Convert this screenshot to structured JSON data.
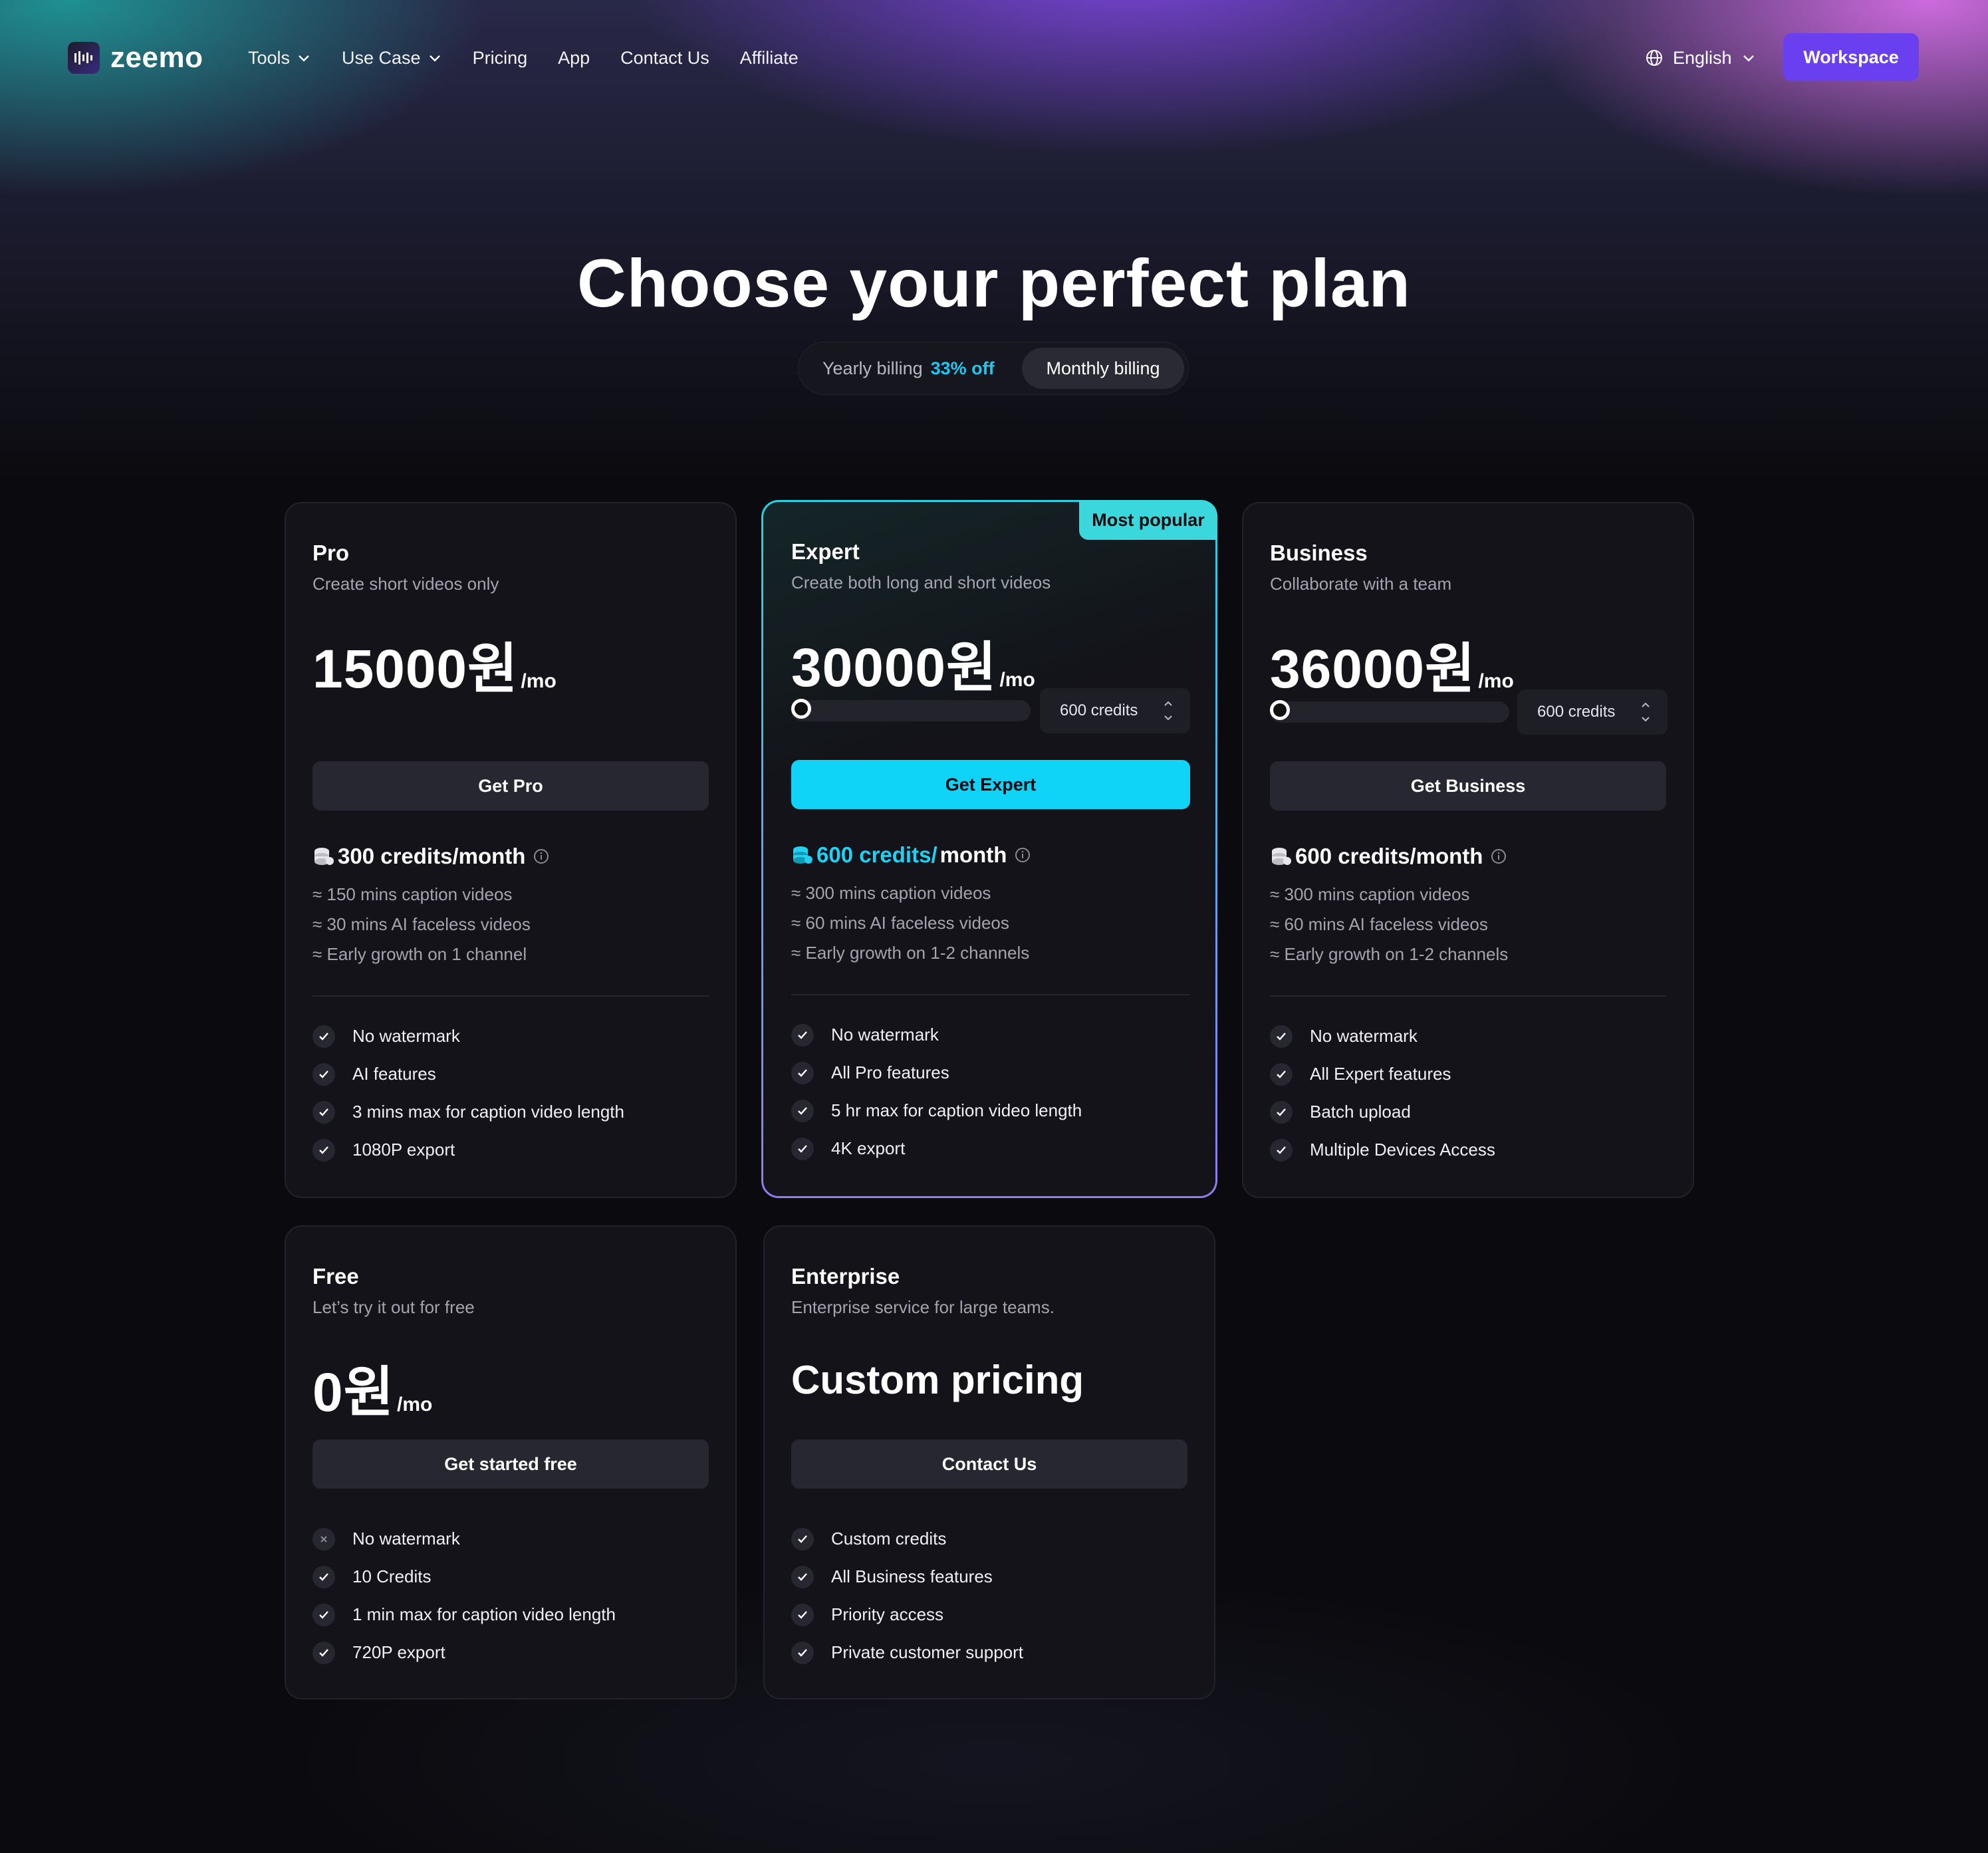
{
  "nav": {
    "brand": "zeemo",
    "links": [
      {
        "label": "Tools",
        "dropdown": true
      },
      {
        "label": "Use Case",
        "dropdown": true
      },
      {
        "label": "Pricing",
        "dropdown": false
      },
      {
        "label": "App",
        "dropdown": false
      },
      {
        "label": "Contact Us",
        "dropdown": false
      },
      {
        "label": "Affiliate",
        "dropdown": false
      }
    ],
    "language": "English",
    "workspace_label": "Workspace"
  },
  "hero": {
    "title": "Choose your perfect plan"
  },
  "billing": {
    "yearly_label": "Yearly billing",
    "yearly_discount": "33% off",
    "monthly_label": "Monthly billing",
    "selected": "monthly"
  },
  "plans": {
    "pro": {
      "name": "Pro",
      "subtitle": "Create short videos only",
      "price": "15000원",
      "period": "/mo",
      "cta": "Get Pro",
      "credits": "300 credits/month",
      "approx": [
        "≈ 150 mins caption videos",
        "≈ 30 mins AI faceless videos",
        "≈ Early growth on 1 channel"
      ],
      "features": [
        "No watermark",
        "AI features",
        "3 mins max for caption video length",
        "1080P export"
      ]
    },
    "expert": {
      "badge": "Most popular",
      "name": "Expert",
      "subtitle": "Create both long and short videos",
      "price": "30000원",
      "period": "/mo",
      "credit_select": "600 credits",
      "slider_level": 0,
      "cta": "Get Expert",
      "credits_highlight": "600 credits/",
      "credits_suffix": "month",
      "approx": [
        "≈ 300 mins caption videos",
        "≈ 60 mins AI faceless videos",
        "≈ Early growth on 1-2 channels"
      ],
      "features": [
        "No watermark",
        "All Pro features",
        "5 hr max for caption video length",
        "4K export"
      ]
    },
    "business": {
      "name": "Business",
      "subtitle": "Collaborate with a team",
      "price": "36000원",
      "period": "/mo",
      "credit_select": "600 credits",
      "slider_level": 0,
      "cta": "Get Business",
      "credits": "600 credits/month",
      "approx": [
        "≈ 300 mins caption videos",
        "≈ 60 mins AI faceless videos",
        "≈ Early growth on 1-2 channels"
      ],
      "features": [
        "No watermark",
        "All Expert features",
        "Batch upload",
        "Multiple Devices Access"
      ]
    },
    "free": {
      "name": "Free",
      "subtitle": "Let’s try it out for free",
      "price": "0원",
      "period": "/mo",
      "cta": "Get started free",
      "features": [
        "No watermark",
        "10 Credits",
        "1 min max for caption video length",
        "720P export"
      ]
    },
    "enterprise": {
      "name": "Enterprise",
      "subtitle": "Enterprise service for large teams.",
      "price": "Custom pricing",
      "cta": "Contact Us",
      "features": [
        "Custom credits",
        "All Business features",
        "Priority access",
        "Private customer support"
      ]
    }
  },
  "colors": {
    "accent_cyan": "#0fd3f7",
    "workspace_purple": "#6a3ff0",
    "badge": "#3ad8dc",
    "background": "#0b0b0f"
  },
  "icons": {
    "language": "globe-icon",
    "feature_included": "check-icon",
    "feature_excluded": "x-icon",
    "credits": "coin-stack-icon",
    "info": "info-circle-icon"
  }
}
